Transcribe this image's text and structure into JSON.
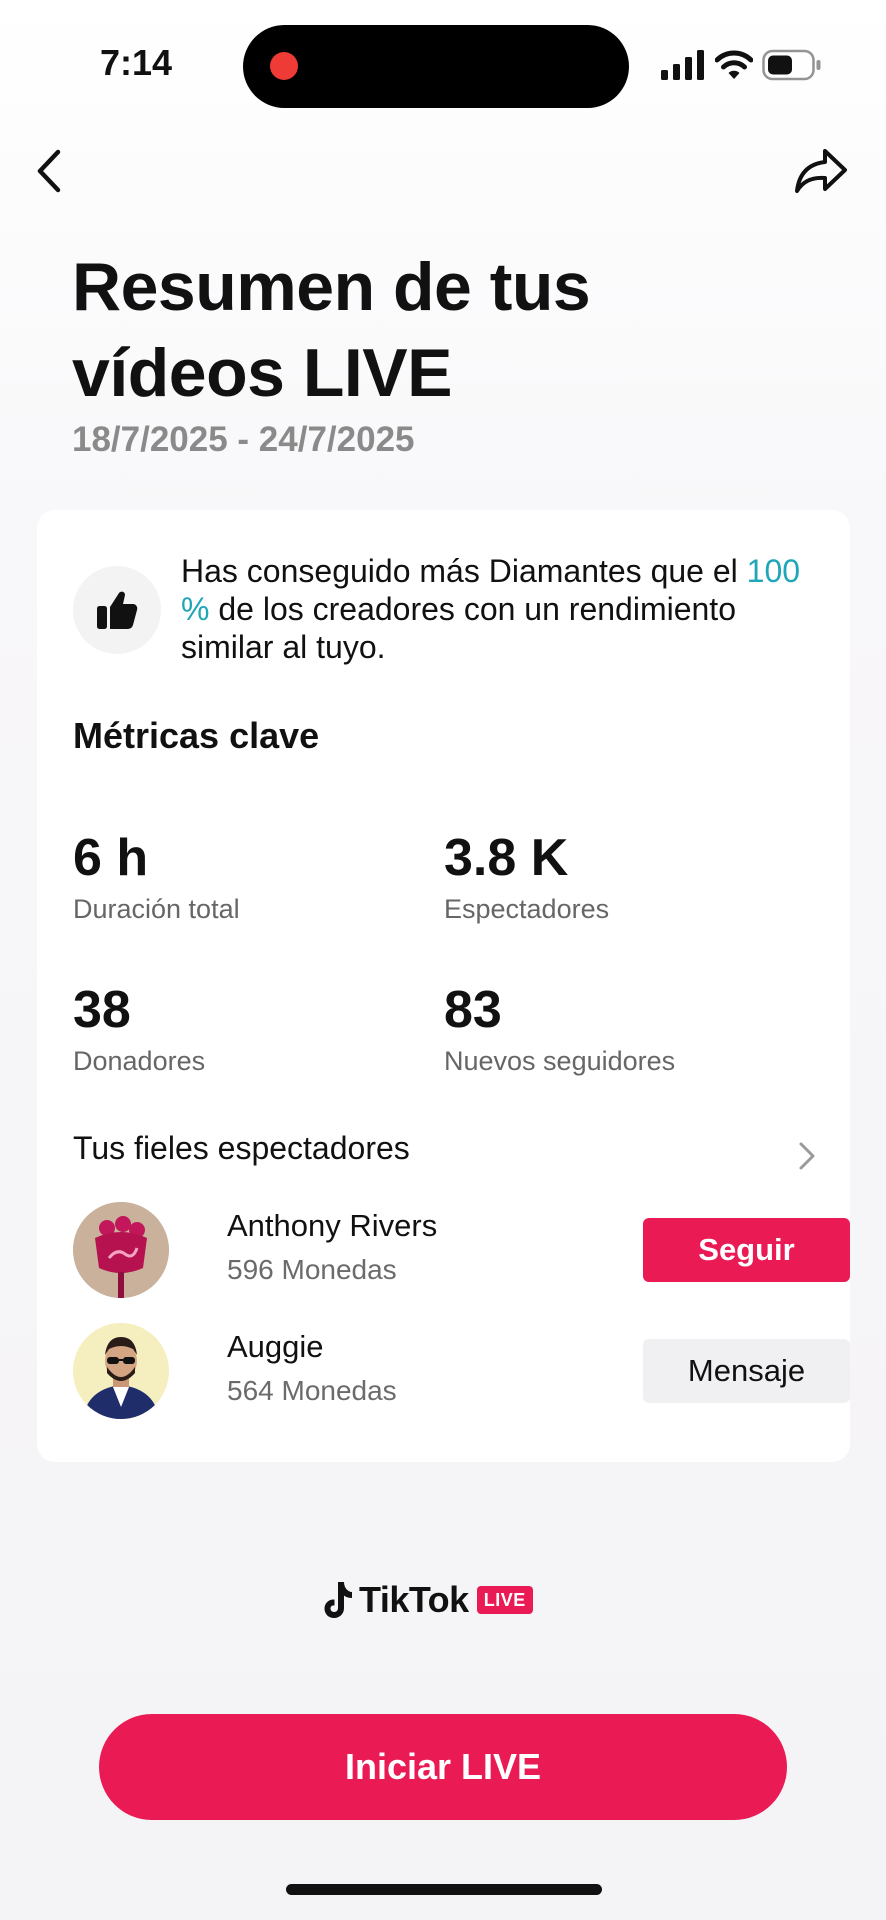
{
  "status_bar": {
    "time": "7:14"
  },
  "header": {
    "title_line1": "Resumen de tus",
    "title_line2": "vídeos LIVE",
    "date_range": "18/7/2025 - 24/7/2025"
  },
  "highlight": {
    "text_before": "Has conseguido más Diamantes que el",
    "percent": "100 %",
    "text_after": "de los creadores con un rendimiento similar al tuyo.",
    "accent_color": "#1fa6b8"
  },
  "metrics": {
    "title": "Métricas clave",
    "items": [
      {
        "value": "6 h",
        "label": "Duración total"
      },
      {
        "value": "3.8 K",
        "label": "Espectadores"
      },
      {
        "value": "38",
        "label": "Donadores"
      },
      {
        "value": "83",
        "label": "Nuevos seguidores"
      }
    ]
  },
  "fans": {
    "title": "Tus fieles espectadores",
    "items": [
      {
        "name": "Anthony Rivers",
        "coins": "596 Monedas",
        "action": "Seguir"
      },
      {
        "name": "Auggie",
        "coins": "564 Monedas",
        "action": "Mensaje"
      }
    ]
  },
  "logo": {
    "brand": "TikTok",
    "badge": "LIVE"
  },
  "cta": {
    "label": "Iniciar LIVE"
  },
  "colors": {
    "brand_pink": "#ea1a54",
    "accent_teal": "#1fa6b8"
  },
  "icons": [
    "back-chevron-icon",
    "share-arrow-icon",
    "thumbs-up-icon",
    "chevron-right-icon",
    "tiktok-note-icon"
  ]
}
